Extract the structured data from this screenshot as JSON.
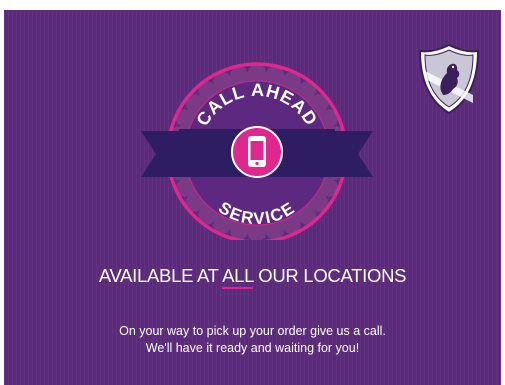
{
  "badge": {
    "top_text": "CALL AHEAD",
    "bottom_text": "SERVICE",
    "icon": "smartphone-icon"
  },
  "headline": {
    "before": "AVAILABLE AT ",
    "emphasis": "ALL",
    "after": " OUR LOCATIONS"
  },
  "body": {
    "line1": "On your way to pick up your order give us a call.",
    "line2": "We'll have it ready and waiting for you!"
  },
  "logo": {
    "name": "crest-shield-logo"
  },
  "colors": {
    "background": "#5b2a7a",
    "accent": "#e0268f",
    "ribbon": "#2e1d63",
    "rosette": "#7a3a86"
  }
}
